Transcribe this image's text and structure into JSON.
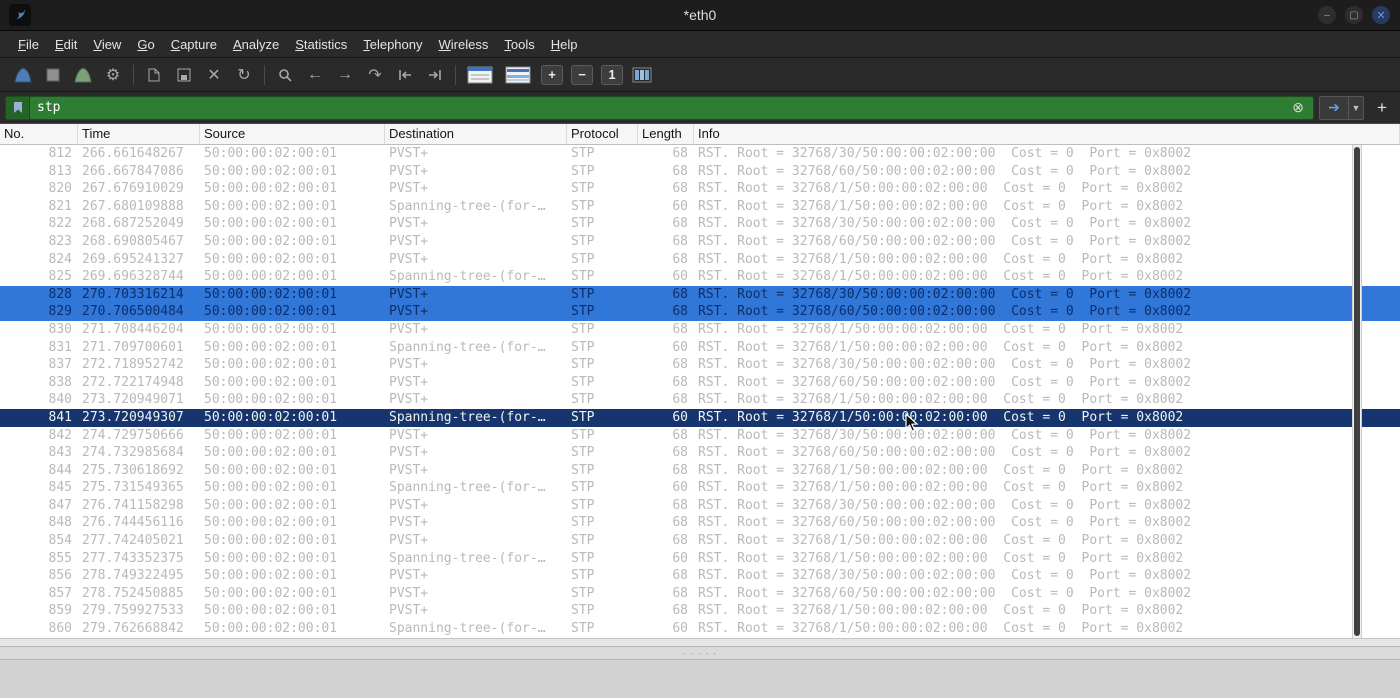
{
  "window": {
    "title": "*eth0",
    "buttons": {
      "minimize": "–",
      "maximize": "▢",
      "close": "✕"
    }
  },
  "menu": {
    "items": [
      "File",
      "Edit",
      "View",
      "Go",
      "Capture",
      "Analyze",
      "Statistics",
      "Telephony",
      "Wireless",
      "Tools",
      "Help"
    ]
  },
  "toolbar": {
    "icons": [
      "capture-start",
      "capture-stop",
      "capture-restart",
      "capture-options",
      "open-file",
      "save-file",
      "close-file",
      "reload",
      "find-packet",
      "go-back",
      "go-forward",
      "go-to-packet",
      "previous-packet",
      "next-packet",
      "auto-scroll",
      "colorize",
      "zoom-in",
      "zoom-out",
      "normal-size",
      "resize-columns"
    ],
    "close_file_glyph": "✕",
    "reload_glyph": "↻",
    "gear_glyph": "⚙",
    "back_glyph": "←",
    "forward_glyph": "→",
    "goto_glyph": "↷",
    "zoom_in": "+",
    "zoom_out": "−",
    "zoom_reset": "1"
  },
  "filter": {
    "value": "stp",
    "clear_glyph": "⊗",
    "apply_glyph": "➔",
    "dropdown_glyph": "▼",
    "add_label": "+"
  },
  "packet_list": {
    "columns": [
      "No.",
      "Time",
      "Source",
      "Destination",
      "Protocol",
      "Length",
      "Info"
    ],
    "rows": [
      {
        "no": "812",
        "time": "266.661648267",
        "source": "50:00:00:02:00:01",
        "dest": "PVST+",
        "protocol": "STP",
        "length": "68",
        "info": "RST. Root = 32768/30/50:00:00:02:00:00  Cost = 0  Port = 0x8002",
        "state": "normal"
      },
      {
        "no": "813",
        "time": "266.667847086",
        "source": "50:00:00:02:00:01",
        "dest": "PVST+",
        "protocol": "STP",
        "length": "68",
        "info": "RST. Root = 32768/60/50:00:00:02:00:00  Cost = 0  Port = 0x8002",
        "state": "normal"
      },
      {
        "no": "820",
        "time": "267.676910029",
        "source": "50:00:00:02:00:01",
        "dest": "PVST+",
        "protocol": "STP",
        "length": "68",
        "info": "RST. Root = 32768/1/50:00:00:02:00:00  Cost = 0  Port = 0x8002",
        "state": "normal"
      },
      {
        "no": "821",
        "time": "267.680109888",
        "source": "50:00:00:02:00:01",
        "dest": "Spanning-tree-(for-…",
        "protocol": "STP",
        "length": "60",
        "info": "RST. Root = 32768/1/50:00:00:02:00:00  Cost = 0  Port = 0x8002",
        "state": "normal"
      },
      {
        "no": "822",
        "time": "268.687252049",
        "source": "50:00:00:02:00:01",
        "dest": "PVST+",
        "protocol": "STP",
        "length": "68",
        "info": "RST. Root = 32768/30/50:00:00:02:00:00  Cost = 0  Port = 0x8002",
        "state": "normal"
      },
      {
        "no": "823",
        "time": "268.690805467",
        "source": "50:00:00:02:00:01",
        "dest": "PVST+",
        "protocol": "STP",
        "length": "68",
        "info": "RST. Root = 32768/60/50:00:00:02:00:00  Cost = 0  Port = 0x8002",
        "state": "normal"
      },
      {
        "no": "824",
        "time": "269.695241327",
        "source": "50:00:00:02:00:01",
        "dest": "PVST+",
        "protocol": "STP",
        "length": "68",
        "info": "RST. Root = 32768/1/50:00:00:02:00:00  Cost = 0  Port = 0x8002",
        "state": "normal"
      },
      {
        "no": "825",
        "time": "269.696328744",
        "source": "50:00:00:02:00:01",
        "dest": "Spanning-tree-(for-…",
        "protocol": "STP",
        "length": "60",
        "info": "RST. Root = 32768/1/50:00:00:02:00:00  Cost = 0  Port = 0x8002",
        "state": "normal"
      },
      {
        "no": "828",
        "time": "270.703316214",
        "source": "50:00:00:02:00:01",
        "dest": "PVST+",
        "protocol": "STP",
        "length": "68",
        "info": "RST. Root = 32768/30/50:00:00:02:00:00  Cost = 0  Port = 0x8002",
        "state": "selected"
      },
      {
        "no": "829",
        "time": "270.706500484",
        "source": "50:00:00:02:00:01",
        "dest": "PVST+",
        "protocol": "STP",
        "length": "68",
        "info": "RST. Root = 32768/60/50:00:00:02:00:00  Cost = 0  Port = 0x8002",
        "state": "selected"
      },
      {
        "no": "830",
        "time": "271.708446204",
        "source": "50:00:00:02:00:01",
        "dest": "PVST+",
        "protocol": "STP",
        "length": "68",
        "info": "RST. Root = 32768/1/50:00:00:02:00:00  Cost = 0  Port = 0x8002",
        "state": "normal"
      },
      {
        "no": "831",
        "time": "271.709700601",
        "source": "50:00:00:02:00:01",
        "dest": "Spanning-tree-(for-…",
        "protocol": "STP",
        "length": "60",
        "info": "RST. Root = 32768/1/50:00:00:02:00:00  Cost = 0  Port = 0x8002",
        "state": "normal"
      },
      {
        "no": "837",
        "time": "272.718952742",
        "source": "50:00:00:02:00:01",
        "dest": "PVST+",
        "protocol": "STP",
        "length": "68",
        "info": "RST. Root = 32768/30/50:00:00:02:00:00  Cost = 0  Port = 0x8002",
        "state": "normal"
      },
      {
        "no": "838",
        "time": "272.722174948",
        "source": "50:00:00:02:00:01",
        "dest": "PVST+",
        "protocol": "STP",
        "length": "68",
        "info": "RST. Root = 32768/60/50:00:00:02:00:00  Cost = 0  Port = 0x8002",
        "state": "normal"
      },
      {
        "no": "840",
        "time": "273.720949071",
        "source": "50:00:00:02:00:01",
        "dest": "PVST+",
        "protocol": "STP",
        "length": "68",
        "info": "RST. Root = 32768/1/50:00:00:02:00:00  Cost = 0  Port = 0x8002",
        "state": "normal"
      },
      {
        "no": "841",
        "time": "273.720949307",
        "source": "50:00:00:02:00:01",
        "dest": "Spanning-tree-(for-…",
        "protocol": "STP",
        "length": "60",
        "info": "RST. Root = 32768/1/50:00:00:02:00:00  Cost = 0  Port = 0x8002",
        "state": "focused"
      },
      {
        "no": "842",
        "time": "274.729750666",
        "source": "50:00:00:02:00:01",
        "dest": "PVST+",
        "protocol": "STP",
        "length": "68",
        "info": "RST. Root = 32768/30/50:00:00:02:00:00  Cost = 0  Port = 0x8002",
        "state": "normal"
      },
      {
        "no": "843",
        "time": "274.732985684",
        "source": "50:00:00:02:00:01",
        "dest": "PVST+",
        "protocol": "STP",
        "length": "68",
        "info": "RST. Root = 32768/60/50:00:00:02:00:00  Cost = 0  Port = 0x8002",
        "state": "normal"
      },
      {
        "no": "844",
        "time": "275.730618692",
        "source": "50:00:00:02:00:01",
        "dest": "PVST+",
        "protocol": "STP",
        "length": "68",
        "info": "RST. Root = 32768/1/50:00:00:02:00:00  Cost = 0  Port = 0x8002",
        "state": "normal"
      },
      {
        "no": "845",
        "time": "275.731549365",
        "source": "50:00:00:02:00:01",
        "dest": "Spanning-tree-(for-…",
        "protocol": "STP",
        "length": "60",
        "info": "RST. Root = 32768/1/50:00:00:02:00:00  Cost = 0  Port = 0x8002",
        "state": "normal"
      },
      {
        "no": "847",
        "time": "276.741158298",
        "source": "50:00:00:02:00:01",
        "dest": "PVST+",
        "protocol": "STP",
        "length": "68",
        "info": "RST. Root = 32768/30/50:00:00:02:00:00  Cost = 0  Port = 0x8002",
        "state": "normal"
      },
      {
        "no": "848",
        "time": "276.744456116",
        "source": "50:00:00:02:00:01",
        "dest": "PVST+",
        "protocol": "STP",
        "length": "68",
        "info": "RST. Root = 32768/60/50:00:00:02:00:00  Cost = 0  Port = 0x8002",
        "state": "normal"
      },
      {
        "no": "854",
        "time": "277.742405021",
        "source": "50:00:00:02:00:01",
        "dest": "PVST+",
        "protocol": "STP",
        "length": "68",
        "info": "RST. Root = 32768/1/50:00:00:02:00:00  Cost = 0  Port = 0x8002",
        "state": "normal"
      },
      {
        "no": "855",
        "time": "277.743352375",
        "source": "50:00:00:02:00:01",
        "dest": "Spanning-tree-(for-…",
        "protocol": "STP",
        "length": "60",
        "info": "RST. Root = 32768/1/50:00:00:02:00:00  Cost = 0  Port = 0x8002",
        "state": "normal"
      },
      {
        "no": "856",
        "time": "278.749322495",
        "source": "50:00:00:02:00:01",
        "dest": "PVST+",
        "protocol": "STP",
        "length": "68",
        "info": "RST. Root = 32768/30/50:00:00:02:00:00  Cost = 0  Port = 0x8002",
        "state": "normal"
      },
      {
        "no": "857",
        "time": "278.752450885",
        "source": "50:00:00:02:00:01",
        "dest": "PVST+",
        "protocol": "STP",
        "length": "68",
        "info": "RST. Root = 32768/60/50:00:00:02:00:00  Cost = 0  Port = 0x8002",
        "state": "normal"
      },
      {
        "no": "859",
        "time": "279.759927533",
        "source": "50:00:00:02:00:01",
        "dest": "PVST+",
        "protocol": "STP",
        "length": "68",
        "info": "RST. Root = 32768/1/50:00:00:02:00:00  Cost = 0  Port = 0x8002",
        "state": "normal"
      },
      {
        "no": "860",
        "time": "279.762668842",
        "source": "50:00:00:02:00:01",
        "dest": "Spanning-tree-(for-…",
        "protocol": "STP",
        "length": "60",
        "info": "RST. Root = 32768/1/50:00:00:02:00:00  Cost = 0  Port = 0x8002",
        "state": "normal"
      }
    ]
  },
  "splitter": {
    "handle": "· · · · ·"
  },
  "colors": {
    "filter_valid_bg": "#2e7d32",
    "selected_bg": "#3177d8",
    "focused_bg": "#16356e",
    "faded_text": "#b9b9b9",
    "titlebar_bg": "#1d1d1d",
    "chrome_bg": "#2a2a2a"
  }
}
